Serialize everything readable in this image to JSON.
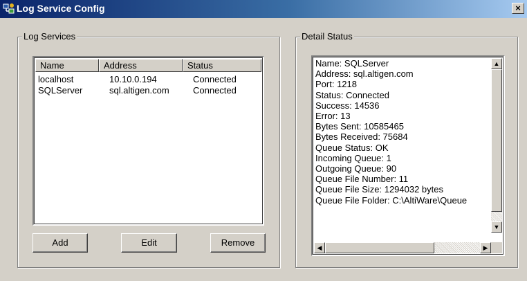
{
  "window": {
    "title": "Log Service Config",
    "close_glyph": "×",
    "icon": "app-network-icon"
  },
  "log_services": {
    "group_label": "Log Services",
    "columns": [
      "Name",
      "Address",
      "Status"
    ],
    "rows": [
      {
        "name": "localhost",
        "address": "10.10.0.194",
        "status": "Connected"
      },
      {
        "name": "SQLServer",
        "address": "sql.altigen.com",
        "status": "Connected"
      }
    ],
    "buttons": {
      "add": "Add",
      "edit": "Edit",
      "remove": "Remove"
    }
  },
  "detail_status": {
    "group_label": "Detail Status",
    "lines": [
      "Name: SQLServer",
      "Address: sql.altigen.com",
      "Port: 1218",
      "Status: Connected",
      "Success: 14536",
      "Error: 13",
      "Bytes Sent: 10585465",
      "Bytes Received: 75684",
      "Queue Status: OK",
      "Incoming Queue: 1",
      "Outgoing Queue: 90",
      "Queue File Number: 11",
      "Queue File Size: 1294032 bytes",
      "Queue File Folder: C:\\AltiWare\\Queue"
    ],
    "scroll_up": "▲",
    "scroll_down": "▼",
    "scroll_left": "◀",
    "scroll_right": "▶"
  }
}
